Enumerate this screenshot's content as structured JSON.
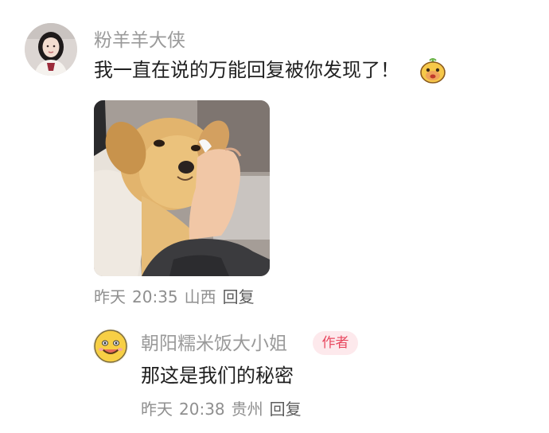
{
  "comment": {
    "username": "粉羊羊大侠",
    "text": "我一直在说的万能回复被你发现了！",
    "sticker_icon": "cartoon-face-sticker",
    "photo_icon": "puppy-photo",
    "meta": {
      "day": "昨天",
      "time": "20:35",
      "location": "山西",
      "reply_label": "回复"
    }
  },
  "reply": {
    "username": "朝阳糯米饭大小姐",
    "badge": "作者",
    "text": "那这是我们的秘密",
    "meta": {
      "day": "昨天",
      "time": "20:38",
      "location": "贵州",
      "reply_label": "回复"
    }
  },
  "colors": {
    "username": "#9a9a9a",
    "text": "#1f1f1f",
    "meta": "#8f8f8f",
    "badge_bg": "#fde9ec",
    "badge_fg": "#e8485f"
  }
}
